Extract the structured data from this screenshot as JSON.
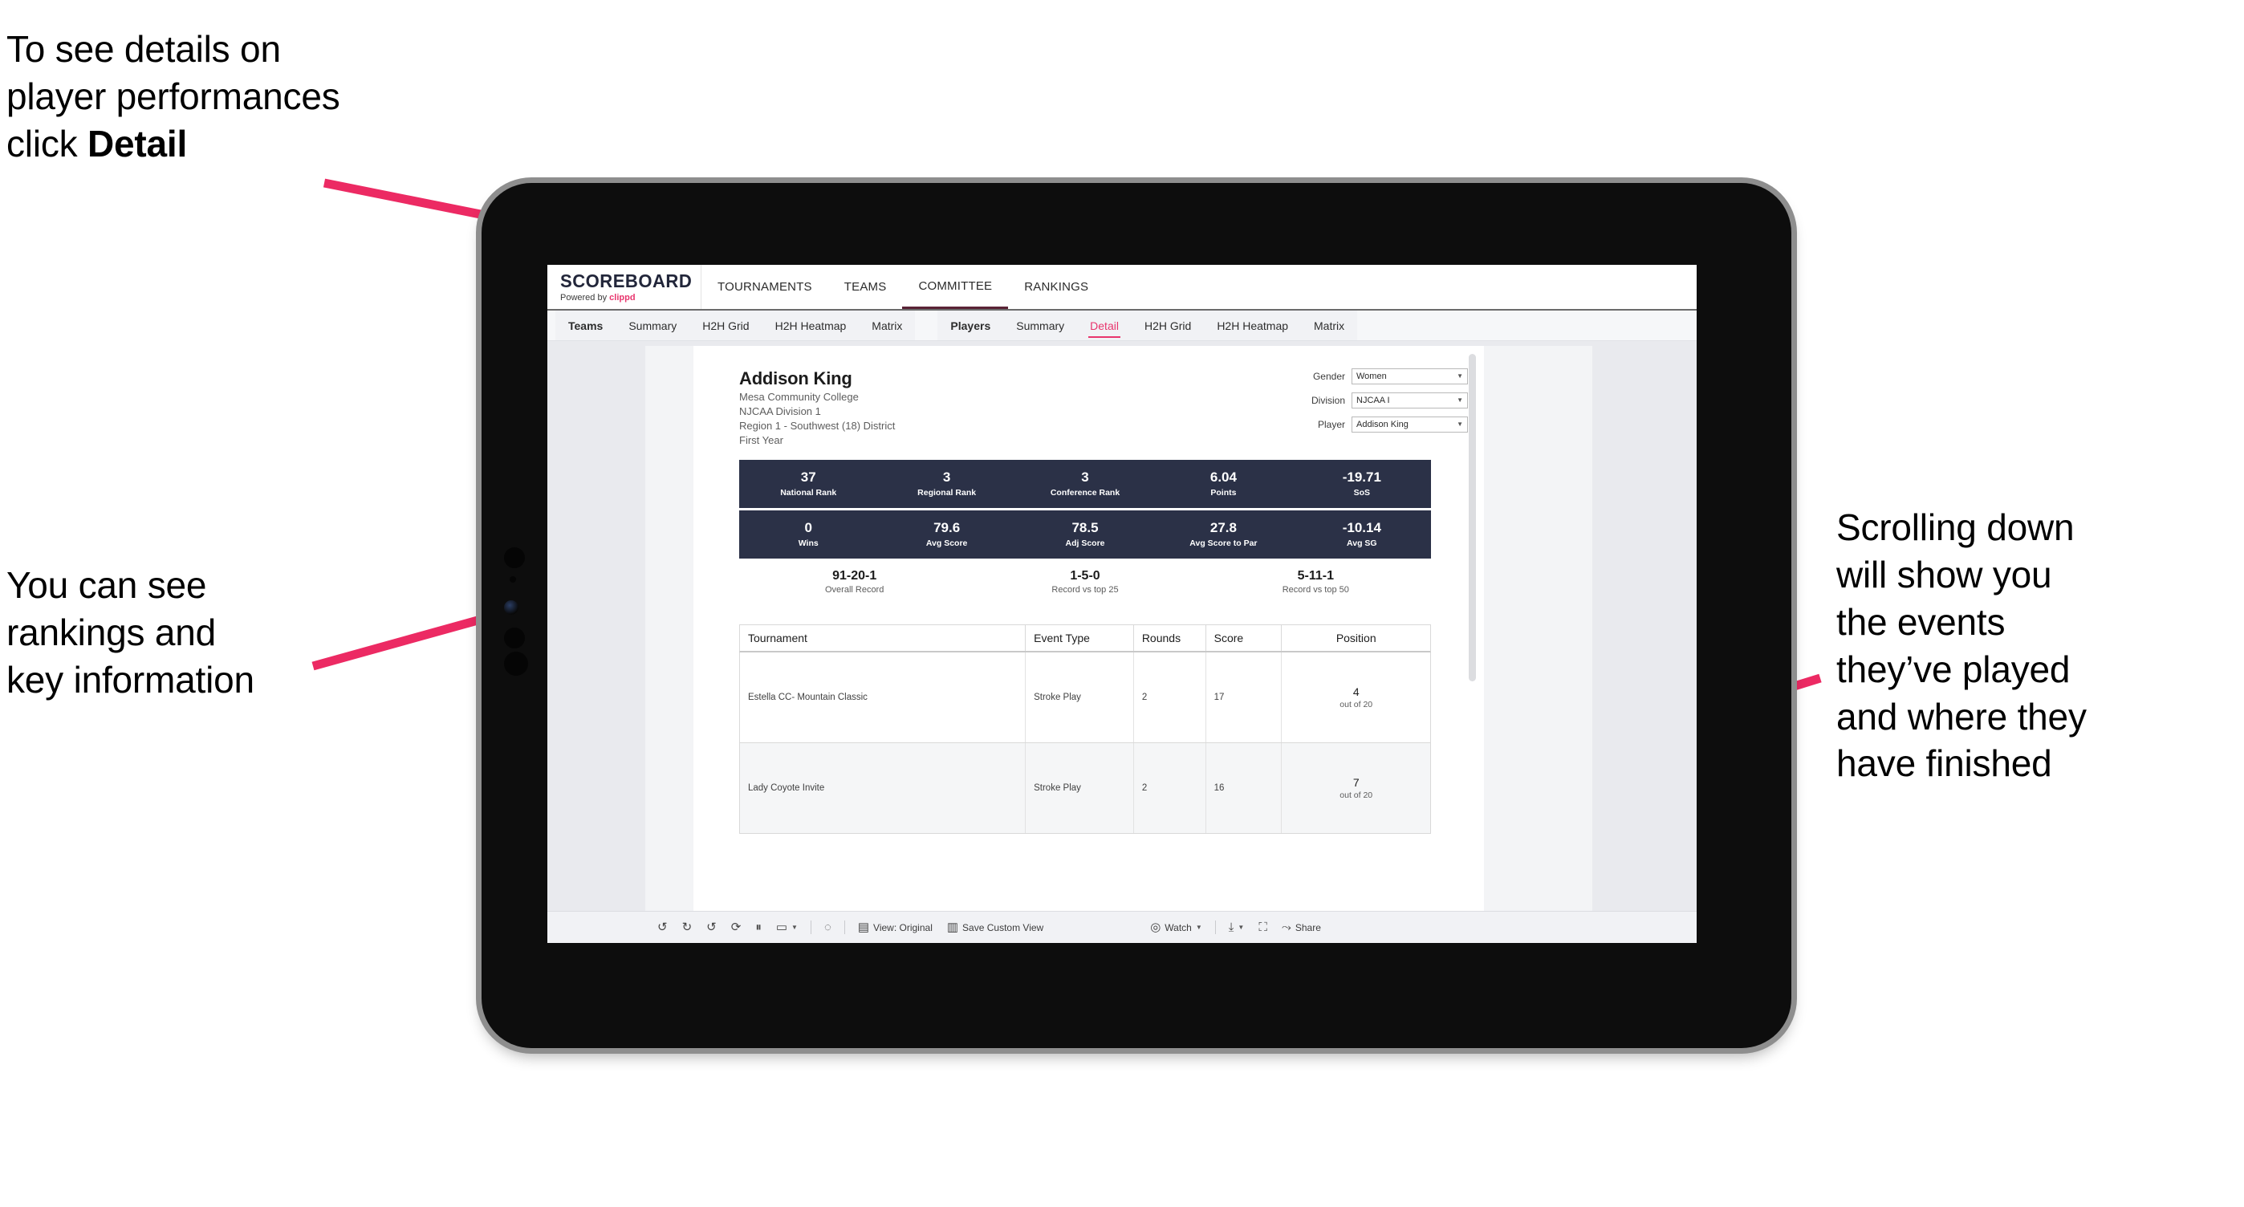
{
  "annotations": {
    "top_left": "To see details on\nplayer performances\nclick ",
    "top_left_bold": "Detail",
    "mid_left": "You can see\nrankings and\nkey information",
    "right": "Scrolling down\nwill show you\nthe events\nthey’ve played\nand where they\nhave finished",
    "accent_color": "#ec2a63"
  },
  "app": {
    "brand": {
      "title": "SCOREBOARD",
      "powered_prefix": "Powered by ",
      "powered_name": "clippd"
    },
    "topnav": [
      {
        "label": "TOURNAMENTS",
        "active": false
      },
      {
        "label": "TEAMS",
        "active": false
      },
      {
        "label": "COMMITTEE",
        "active": true
      },
      {
        "label": "RANKINGS",
        "active": false
      }
    ],
    "subnav": {
      "group_teams": [
        {
          "label": "Teams",
          "head": true,
          "selected": false
        },
        {
          "label": "Summary",
          "head": false,
          "selected": false
        },
        {
          "label": "H2H Grid",
          "head": false,
          "selected": false
        },
        {
          "label": "H2H Heatmap",
          "head": false,
          "selected": false
        },
        {
          "label": "Matrix",
          "head": false,
          "selected": false
        }
      ],
      "group_players": [
        {
          "label": "Players",
          "head": true,
          "selected": false
        },
        {
          "label": "Summary",
          "head": false,
          "selected": false
        },
        {
          "label": "Detail",
          "head": false,
          "selected": true
        },
        {
          "label": "H2H Grid",
          "head": false,
          "selected": false
        },
        {
          "label": "H2H Heatmap",
          "head": false,
          "selected": false
        },
        {
          "label": "Matrix",
          "head": false,
          "selected": false
        }
      ]
    }
  },
  "player": {
    "name": "Addison King",
    "school": "Mesa Community College",
    "division": "NJCAA Division 1",
    "region": "Region 1 - Southwest (18) District",
    "year": "First Year"
  },
  "filters": [
    {
      "label": "Gender",
      "value": "Women"
    },
    {
      "label": "Division",
      "value": "NJCAA I"
    },
    {
      "label": "Player",
      "value": "Addison King"
    }
  ],
  "stats_row_1": [
    {
      "value": "37",
      "label": "National Rank"
    },
    {
      "value": "3",
      "label": "Regional Rank"
    },
    {
      "value": "3",
      "label": "Conference Rank"
    },
    {
      "value": "6.04",
      "label": "Points"
    },
    {
      "value": "-19.71",
      "label": "SoS"
    }
  ],
  "stats_row_2": [
    {
      "value": "0",
      "label": "Wins"
    },
    {
      "value": "79.6",
      "label": "Avg Score"
    },
    {
      "value": "78.5",
      "label": "Adj Score"
    },
    {
      "value": "27.8",
      "label": "Avg Score to Par"
    },
    {
      "value": "-10.14",
      "label": "Avg SG"
    }
  ],
  "records": [
    {
      "value": "91-20-1",
      "label": "Overall Record"
    },
    {
      "value": "1-5-0",
      "label": "Record vs top 25"
    },
    {
      "value": "5-11-1",
      "label": "Record vs top 50"
    }
  ],
  "events_table": {
    "columns": [
      "Tournament",
      "Event Type",
      "Rounds",
      "Score",
      "Position"
    ],
    "rows": [
      {
        "tournament": "Estella CC- Mountain Classic",
        "event_type": "Stroke Play",
        "rounds": "2",
        "score": "17",
        "position": "4",
        "position_sub": "out of 20"
      },
      {
        "tournament": "Lady Coyote Invite",
        "event_type": "Stroke Play",
        "rounds": "2",
        "score": "16",
        "position": "7",
        "position_sub": "out of 20"
      }
    ]
  },
  "toolbar": {
    "undo_icon": "undo-icon",
    "redo_icon": "redo-icon",
    "revert_icon": "revert-icon",
    "refresh_icon": "refresh-icon",
    "pause_icon": "pause-icon",
    "alert_icon": "alert-icon",
    "history_icon": "history-icon",
    "view_label": "View: Original",
    "save_label": "Save Custom View",
    "watch_label": "Watch",
    "download_icon": "download-icon",
    "fullscreen_icon": "fullscreen-icon",
    "share_label": "Share"
  }
}
